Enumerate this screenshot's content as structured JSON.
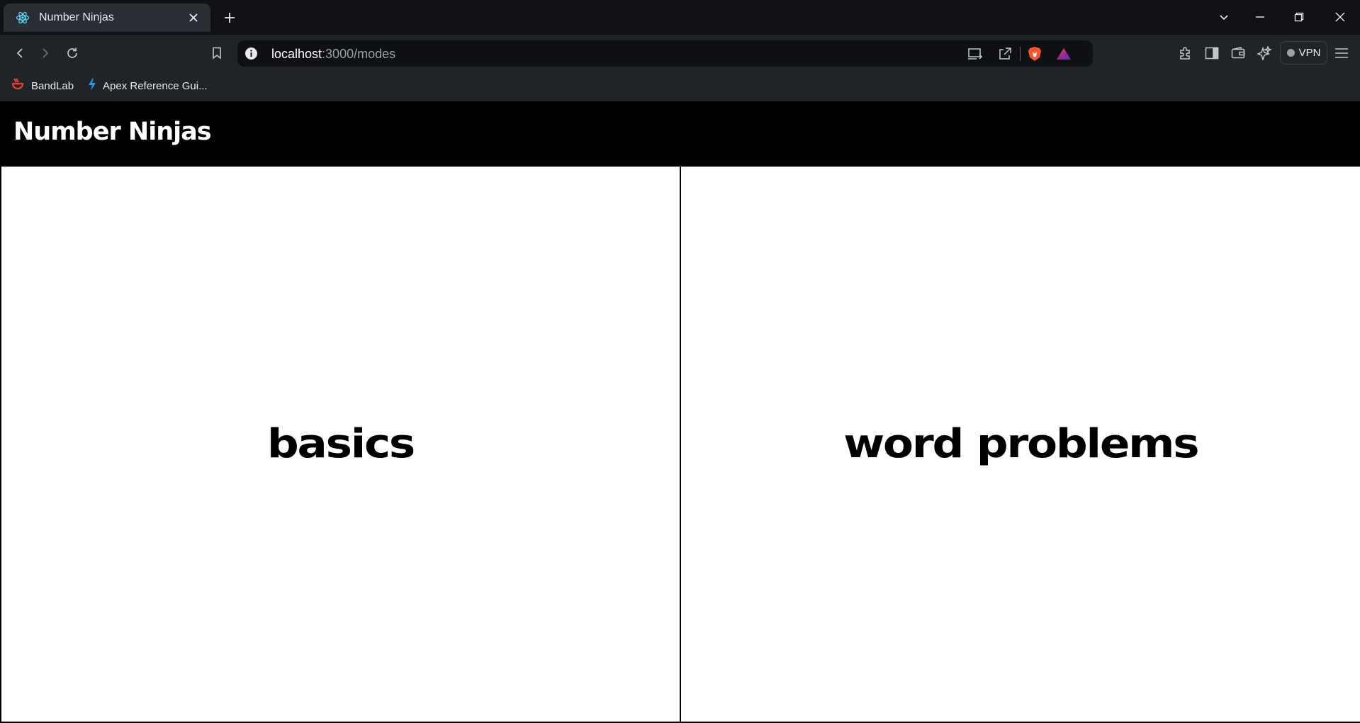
{
  "browser": {
    "tab": {
      "title": "Number Ninjas",
      "favicon": "react-atom-icon"
    },
    "url": {
      "host": "localhost",
      "path": ":3000/modes"
    },
    "bookmarks": [
      {
        "label": "BandLab",
        "icon": "bandlab-icon"
      },
      {
        "label": "Apex Reference Gui...",
        "icon": "bolt-icon"
      }
    ],
    "vpn_label": "VPN"
  },
  "page": {
    "title": "Number Ninjas",
    "modes": [
      {
        "label": "basics"
      },
      {
        "label": "word problems"
      }
    ]
  },
  "colors": {
    "header_bg": "#000000",
    "page_bg": "#ffffff",
    "card_border": "#000000",
    "chrome_bg": "#202328",
    "tabstrip_bg": "#0f1115"
  }
}
